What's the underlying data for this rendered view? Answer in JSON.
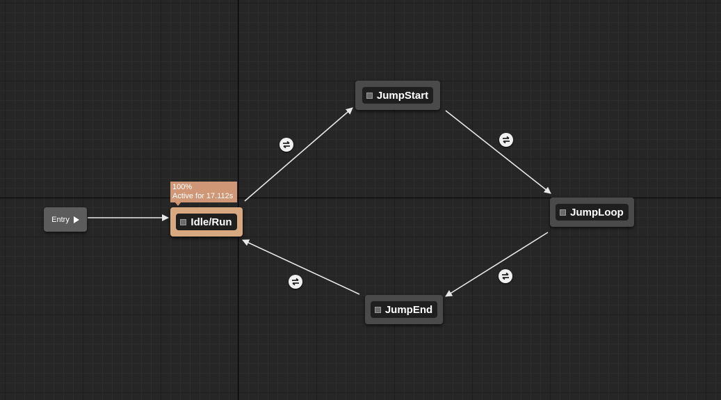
{
  "graph": {
    "entry": {
      "label": "Entry"
    },
    "states": {
      "idle_run": {
        "label": "Idle/Run",
        "active": true
      },
      "jump_start": {
        "label": "JumpStart"
      },
      "jump_loop": {
        "label": "JumpLoop"
      },
      "jump_end": {
        "label": "JumpEnd"
      }
    },
    "active_tooltip": {
      "weight": "100%",
      "duration": "Active for 17.112s"
    }
  },
  "colors": {
    "background": "#262626",
    "active_state": "#d8a880",
    "tooltip": "#cf9775",
    "state": "#4a4a4a"
  },
  "icons": {
    "transition": "transition-rule-icon",
    "state": "state-icon",
    "entry_pin": "exec-pin-icon"
  }
}
